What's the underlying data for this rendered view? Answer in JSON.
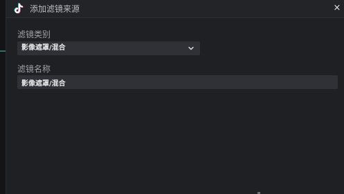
{
  "dialog": {
    "title": "添加滤镜来源",
    "app_icon": "tiktok-logo-icon",
    "close_icon": "close-icon",
    "close_label": "×"
  },
  "form": {
    "category": {
      "label": "滤镜类别",
      "selected": "影像遮罩/混合",
      "dropdown_icon": "chevron-down-icon"
    },
    "name": {
      "label": "滤镜名称",
      "value": "影像遮罩/混合"
    }
  },
  "colors": {
    "background": "#1f2024",
    "titlebar": "#232428",
    "input_bg": "#303137",
    "label_text": "#9ea1a8",
    "value_text": "#e8e8ea",
    "accent": "#2f6f68"
  }
}
